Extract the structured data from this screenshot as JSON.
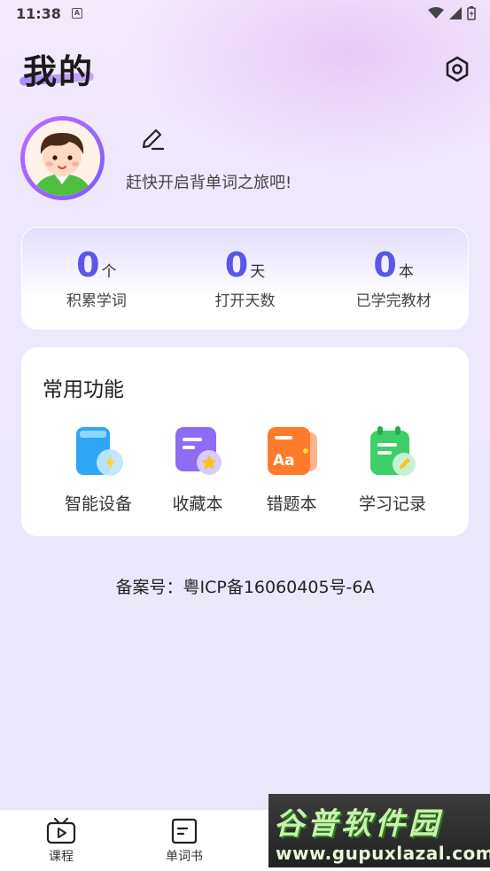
{
  "status_bar": {
    "time": "11:38",
    "notification_glyph": "A"
  },
  "header": {
    "title": "我的"
  },
  "profile": {
    "slogan": "赶快开启背单词之旅吧!"
  },
  "stats": [
    {
      "value": "0",
      "unit": "个",
      "label": "积累学词"
    },
    {
      "value": "0",
      "unit": "天",
      "label": "打开天数"
    },
    {
      "value": "0",
      "unit": "本",
      "label": "已学完教材"
    }
  ],
  "functions": {
    "title": "常用功能",
    "items": [
      {
        "label": "智能设备",
        "icon": "smart-device-icon",
        "color": "#2fa6f5"
      },
      {
        "label": "收藏本",
        "icon": "favorites-icon",
        "color": "#8e6cf3"
      },
      {
        "label": "错题本",
        "icon": "mistakes-book-icon",
        "color": "#ff7a2a"
      },
      {
        "label": "学习记录",
        "icon": "study-record-icon",
        "color": "#3fcf6a"
      }
    ]
  },
  "footer": {
    "icp": "备案号：粤ICP备16060405号-6A"
  },
  "bottom_nav": [
    {
      "label": "课程",
      "icon": "tv-play-icon"
    },
    {
      "label": "单词书",
      "icon": "wordbook-icon"
    }
  ],
  "watermark": {
    "title": "谷普软件园",
    "url": "www.gupuxlazal.com"
  },
  "colors": {
    "accent": "#5b57e8",
    "background": "#ece8fc"
  }
}
